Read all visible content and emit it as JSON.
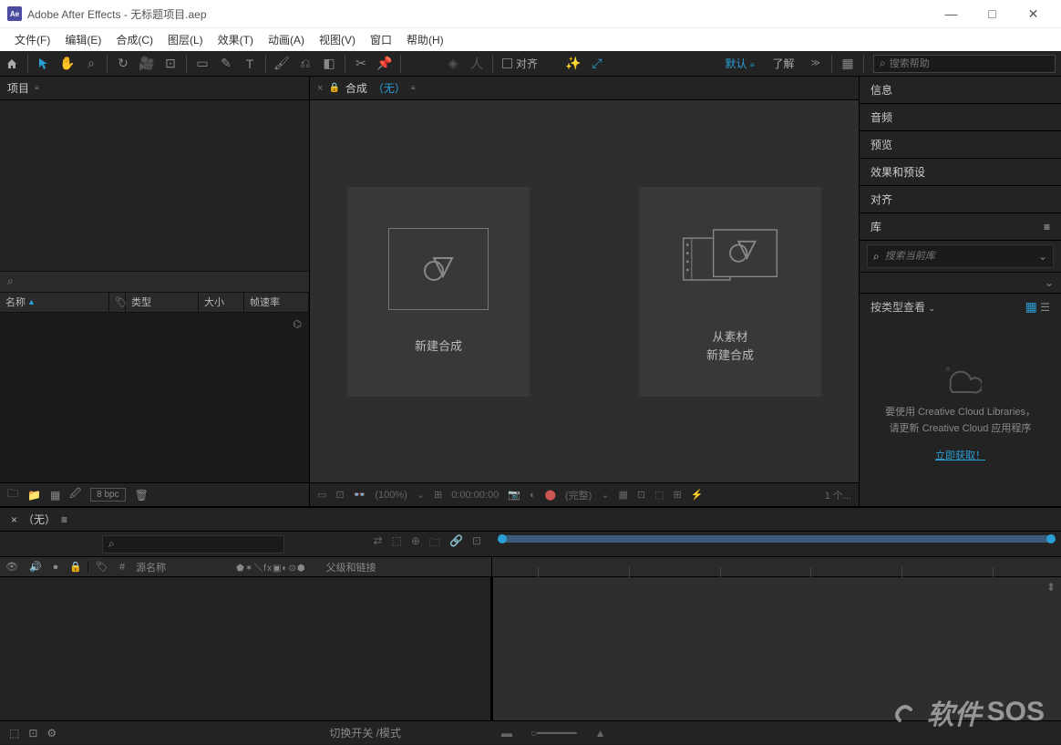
{
  "app": {
    "icon_text": "Ae",
    "title": "Adobe After Effects - 无标题项目.aep"
  },
  "window_controls": {
    "min": "—",
    "max": "□",
    "close": "✕"
  },
  "menu": [
    "文件(F)",
    "编辑(E)",
    "合成(C)",
    "图层(L)",
    "效果(T)",
    "动画(A)",
    "视图(V)",
    "窗口",
    "帮助(H)"
  ],
  "toolbar": {
    "align_label": "对齐",
    "default_label": "默认",
    "learn_label": "了解",
    "search_placeholder": "搜索帮助"
  },
  "project": {
    "tab": "项目",
    "search_icon": "⌕",
    "cols": {
      "name": "名称",
      "type": "类型",
      "size": "大小",
      "fps": "帧速率"
    },
    "footer": {
      "bpc": "8 bpc"
    }
  },
  "composition": {
    "tab_prefix": "合成",
    "tab_value": "（无）",
    "card1": "新建合成",
    "card2_line1": "从素材",
    "card2_line2": "新建合成",
    "footer": {
      "pct": "(100%)",
      "tc": "0:00:00:00",
      "full": "(完整)",
      "cam": "1 个..."
    }
  },
  "right_panels": [
    "信息",
    "音频",
    "预览",
    "效果和预设",
    "对齐"
  ],
  "library": {
    "title": "库",
    "search_placeholder": "搜索当前库",
    "view_label": "按类型查看",
    "msg_line1": "要使用 Creative Cloud Libraries，",
    "msg_line2": "请更新 Creative Cloud 应用程序",
    "link": "立即获取！"
  },
  "timeline": {
    "tab": "（无）",
    "col_source": "源名称",
    "col_parent": "父级和链接",
    "toggle_label": "切换开关 /模式"
  },
  "watermark": {
    "text1": "软件",
    "text2": "SOS"
  }
}
